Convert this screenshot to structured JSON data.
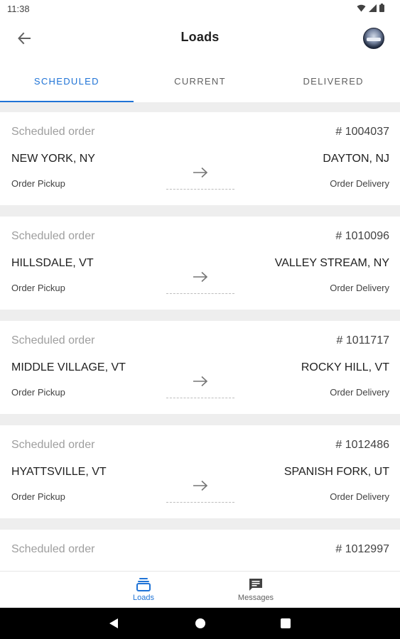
{
  "status_bar": {
    "time": "11:38"
  },
  "app_bar": {
    "title": "Loads"
  },
  "tabs": [
    {
      "label": "SCHEDULED",
      "active": true
    },
    {
      "label": "CURRENT",
      "active": false
    },
    {
      "label": "DELIVERED",
      "active": false
    }
  ],
  "orders": [
    {
      "status": "Scheduled order",
      "number": "# 1004037",
      "origin": "NEW YORK, NY",
      "destination": "DAYTON, NJ",
      "pickup_label": "Order Pickup",
      "delivery_label": "Order Delivery"
    },
    {
      "status": "Scheduled order",
      "number": "# 1010096",
      "origin": "HILLSDALE, VT",
      "destination": "VALLEY STREAM, NY",
      "pickup_label": "Order Pickup",
      "delivery_label": "Order Delivery"
    },
    {
      "status": "Scheduled order",
      "number": "# 1011717",
      "origin": "MIDDLE VILLAGE, VT",
      "destination": "ROCKY HILL, VT",
      "pickup_label": "Order Pickup",
      "delivery_label": "Order Delivery"
    },
    {
      "status": "Scheduled order",
      "number": "# 1012486",
      "origin": "HYATTSVILLE, VT",
      "destination": "SPANISH FORK, UT",
      "pickup_label": "Order Pickup",
      "delivery_label": "Order Delivery"
    },
    {
      "status": "Scheduled order",
      "number": "# 1012997"
    }
  ],
  "bottom_nav": [
    {
      "label": "Loads",
      "icon": "loads-stack-icon",
      "active": true
    },
    {
      "label": "Messages",
      "icon": "message-icon",
      "active": false
    }
  ],
  "colors": {
    "accent": "#1f73d6",
    "muted_text": "#9e9e9e",
    "list_background": "#eeeeee"
  }
}
